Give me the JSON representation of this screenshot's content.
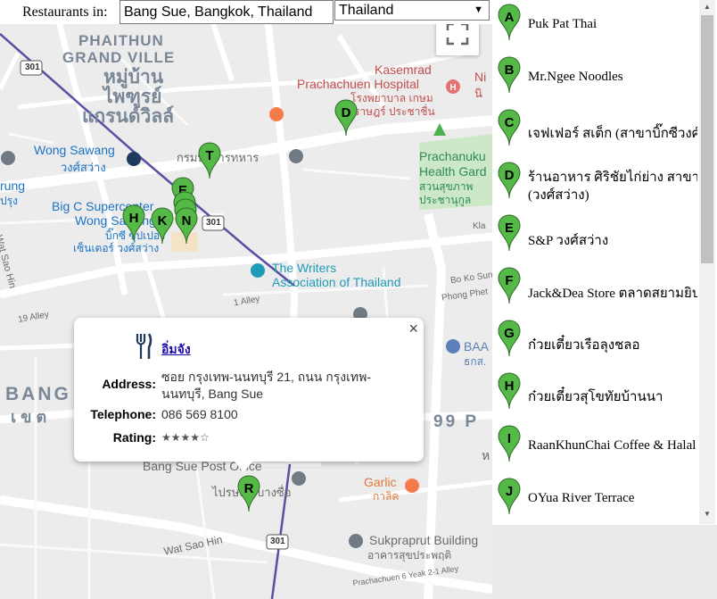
{
  "search": {
    "label": "Restaurants in:",
    "location": "Bang Sue, Bangkok, Thailand",
    "country": "Thailand"
  },
  "map_labels": {
    "phaithun": "PHAITHUN",
    "grand_ville": "GRAND VILLE",
    "thai_village_1": "หมู่บ้าน",
    "thai_village_2": "ไพฑูรย์",
    "thai_village_3": "แกรนด์วิลล์",
    "kasemrad_1": "Kasemrad",
    "kasemrad_2": "Prachachuen Hospital",
    "kasemrad_3": "โรงพยาบาล เกษม",
    "kasemrad_4": "ราษฎร์ ประชาชื่น",
    "wong_sawang": "Wong Sawang",
    "wong_sawang_th": "วงศ์สว่าง",
    "military": "กรมบริการทหาร",
    "prachanukul_1": "Prachanuku",
    "prachanukul_2": "Health Gard",
    "prachanukul_3": "สวนสุขภาพ",
    "prachanukul_4": "ประชานุกูล",
    "bigc_1": "Big C Supercenter",
    "bigc_2": "Wong Sawang",
    "bigc_3": "บิ๊กซี ซุปเปอร์",
    "bigc_4": "เซ็นเตอร์ วงศ์สว่าง",
    "writers_1": "The Writers",
    "writers_2": "Association of Thailand",
    "bang": "BANG",
    "khet": "เขต",
    "ninety_nine": "99 P",
    "post_1": "Bang Sue Post Office",
    "post_2": "ไปรษณีย์บางซื่อ",
    "garlic_1": "Garlic",
    "garlic_2": "กาลิค",
    "sukpra_1": "Sukpraprut Building",
    "sukpra_2": "อาคารสุขประพฤติ",
    "wat_sao_hin": "Wat Sao Hin",
    "wat_sao_hin_2": "Wat Sao Hin",
    "route_301": "301",
    "baa": "BAA",
    "baa_th": "ธกส.",
    "kl": "Kla",
    "bo_ko": "Bo Ko Sun",
    "phong": "Phong Phet",
    "prachachuen": "Prachachuen 6 Yeak 2-1 Alley",
    "alley_19": "19 Alley",
    "alley_1": "1 Alley",
    "runk": "rung",
    "prung": "ปรุง",
    "ni": "Ni",
    "ni_th": "นิ",
    "mi": "ห"
  },
  "markers": [
    {
      "letter": "D"
    },
    {
      "letter": "T"
    },
    {
      "letter": "E"
    },
    {
      "letter": "H"
    },
    {
      "letter": "K"
    },
    {
      "letter": "N"
    },
    {
      "letter": "R"
    }
  ],
  "infowindow": {
    "name": "อิ่มจัง",
    "address_label": "Address:",
    "address": "ซอย กรุงเทพ-นนทบุรี 21, ถนน กรุงเทพ-นนทบุรี, Bang Sue",
    "telephone_label": "Telephone:",
    "telephone": "086 569 8100",
    "rating_label": "Rating:",
    "rating_text": "★★★★☆",
    "rating": 4,
    "close": "×"
  },
  "results": [
    {
      "letter": "A",
      "name": "Puk Pat Thai"
    },
    {
      "letter": "B",
      "name": "Mr.Ngee Noodles"
    },
    {
      "letter": "C",
      "name": "เจฟเฟอร์ สเต็ก (สาขาบิ๊กซีวงศ์สว่าง)"
    },
    {
      "letter": "D",
      "name": "ร้านอาหาร ศิริชัยไก่ย่าง สาขาบางซื่อ",
      "name2": "(วงศ์สว่าง)"
    },
    {
      "letter": "E",
      "name": "S&P วงศ์สว่าง"
    },
    {
      "letter": "F",
      "name": "Jack&Dea Store ตลาดสยามยิปซี"
    },
    {
      "letter": "G",
      "name": "ก๋วยเตี๋ยวเรือลุงชลอ"
    },
    {
      "letter": "H",
      "name": "ก๋วยเตี๋ยวสุโขทัยบ้านนา"
    },
    {
      "letter": "I",
      "name": "RaanKhunChai Coffee & Halal"
    },
    {
      "letter": "J",
      "name": "OYua River Terrace"
    }
  ],
  "colors": {
    "marker_green": "#55b948",
    "marker_stroke": "#2f6b27",
    "map_bg": "#ececec",
    "road": "#ffffff",
    "rail": "#5a4fa3",
    "label_blue": "#1b73c6",
    "label_green": "#2e8b57",
    "label_gray": "#6b6b6b"
  }
}
